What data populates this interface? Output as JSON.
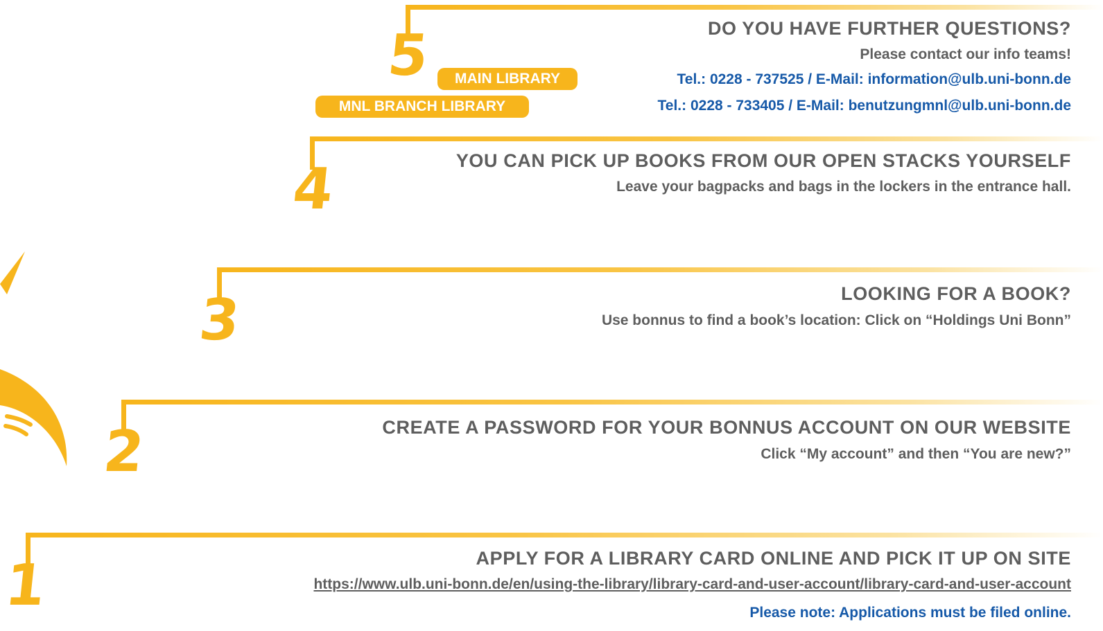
{
  "steps": [
    {
      "number": "5",
      "title": "DO YOU HAVE FURTHER QUESTIONS?",
      "subtitle": "Please contact our info teams!",
      "contacts": [
        {
          "label": "MAIN LIBRARY",
          "text": "Tel.: 0228 - 737525 / E-Mail: information@ulb.uni-bonn.de"
        },
        {
          "label": "MNL BRANCH LIBRARY",
          "text": "Tel.: 0228 - 733405 / E-Mail: benutzungmnl@ulb.uni-bonn.de"
        }
      ]
    },
    {
      "number": "4",
      "title": "YOU CAN PICK UP BOOKS FROM OUR OPEN STACKS YOURSELF",
      "subtitle": "Leave your bagpacks and bags in the lockers in the entrance hall."
    },
    {
      "number": "3",
      "title": "LOOKING FOR A BOOK?",
      "subtitle": "Use bonnus to find a book’s location: Click on “Holdings Uni Bonn”"
    },
    {
      "number": "2",
      "title": "CREATE A PASSWORD FOR YOUR BONNUS ACCOUNT ON OUR WEBSITE",
      "subtitle": "Click “My account” and then “You are new?”"
    },
    {
      "number": "1",
      "title": "APPLY FOR A LIBRARY CARD ONLINE AND PICK IT UP ON SITE",
      "link": "https://www.ulb.uni-bonn.de/en/using-the-library/library-card-and-user-account/library-card-and-user-account",
      "note": "Please note: Applications must be filed online."
    }
  ],
  "colors": {
    "accent": "#f7b51c",
    "text": "#5e5e5e",
    "blue": "#1659a8"
  }
}
